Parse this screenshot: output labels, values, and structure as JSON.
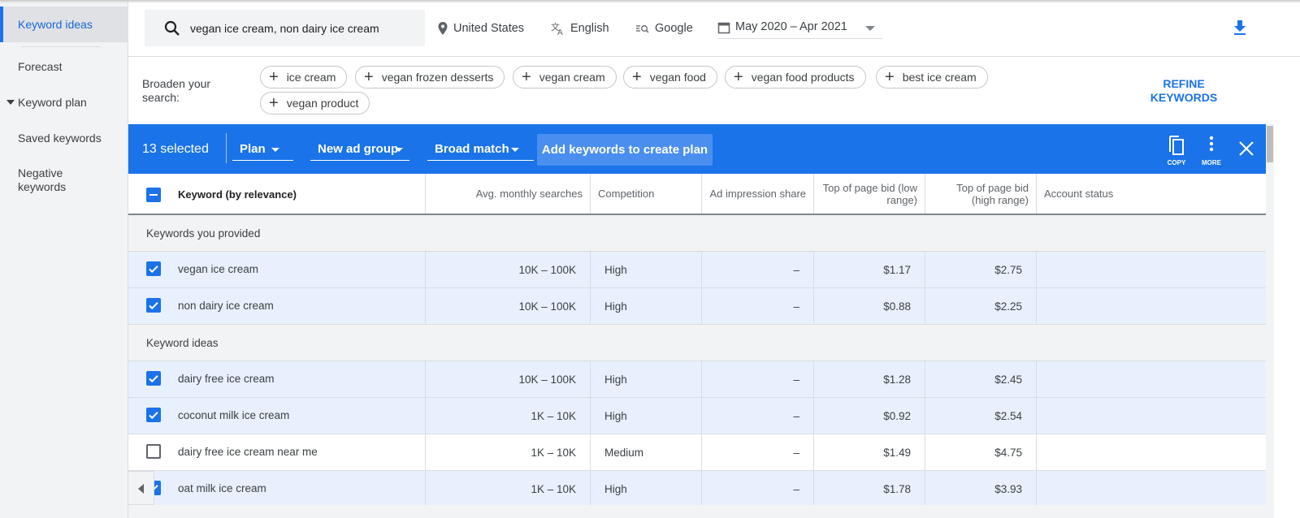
{
  "sidebar": {
    "items": [
      {
        "label": "Keyword ideas",
        "active": true
      },
      {
        "label": "Forecast"
      },
      {
        "label": "Keyword plan",
        "expandable": true
      },
      {
        "label": "Saved keywords"
      },
      {
        "label": "Negative keywords"
      }
    ]
  },
  "topbar": {
    "search_value": "vegan ice cream, non dairy ice cream",
    "location": "United States",
    "language": "English",
    "network": "Google",
    "date_range": "May 2020 – Apr 2021",
    "icons": [
      "search-icon",
      "location-pin-icon",
      "translate-icon",
      "search-network-icon",
      "calendar-icon",
      "download-icon"
    ]
  },
  "broaden": {
    "label": "Broaden your search:",
    "chips": [
      "ice cream",
      "vegan frozen desserts",
      "vegan cream",
      "vegan food",
      "vegan food products",
      "best ice cream",
      "vegan product"
    ],
    "refine_label": "REFINE KEYWORDS"
  },
  "actionbar": {
    "selected": "13 selected",
    "plan": "Plan",
    "ad_group": "New ad group",
    "match": "Broad match",
    "add_button": "Add keywords to create plan",
    "copy": "COPY",
    "more": "MORE",
    "accent": "#1a73e8"
  },
  "table": {
    "headers": {
      "keyword": "Keyword (by relevance)",
      "avg": "Avg. monthly searches",
      "competition": "Competition",
      "impression": "Ad impression share",
      "low": "Top of page bid (low range)",
      "high": "Top of page bid (high range)",
      "account": "Account status"
    },
    "groups": [
      {
        "title": "Keywords you provided",
        "rows": [
          {
            "keyword": "vegan ice cream",
            "avg": "10K – 100K",
            "competition": "High",
            "impression": "–",
            "low": "$1.17",
            "high": "$2.75",
            "account": "",
            "selected": true
          },
          {
            "keyword": "non dairy ice cream",
            "avg": "10K – 100K",
            "competition": "High",
            "impression": "–",
            "low": "$0.88",
            "high": "$2.25",
            "account": "",
            "selected": true
          }
        ]
      },
      {
        "title": "Keyword ideas",
        "rows": [
          {
            "keyword": "dairy free ice cream",
            "avg": "10K – 100K",
            "competition": "High",
            "impression": "–",
            "low": "$1.28",
            "high": "$2.45",
            "account": "",
            "selected": true
          },
          {
            "keyword": "coconut milk ice cream",
            "avg": "1K – 10K",
            "competition": "High",
            "impression": "–",
            "low": "$0.92",
            "high": "$2.54",
            "account": "",
            "selected": true
          },
          {
            "keyword": "dairy free ice cream near me",
            "avg": "1K – 10K",
            "competition": "Medium",
            "impression": "–",
            "low": "$1.49",
            "high": "$4.75",
            "account": "",
            "selected": false
          },
          {
            "keyword": "oat milk ice cream",
            "avg": "1K – 10K",
            "competition": "High",
            "impression": "–",
            "low": "$1.78",
            "high": "$3.93",
            "account": "",
            "selected": true
          }
        ]
      }
    ]
  }
}
